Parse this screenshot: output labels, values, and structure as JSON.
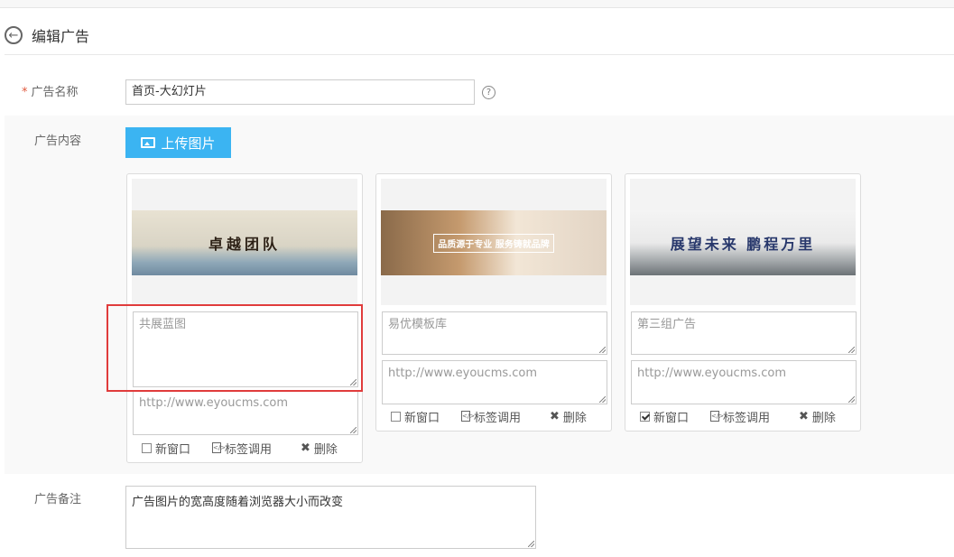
{
  "header": {
    "title": "编辑广告",
    "back_icon": "arrow-left-circle-icon"
  },
  "form": {
    "name_label": "广告名称",
    "required_mark": "*",
    "name_value": "首页-大幻灯片",
    "help_icon": "question-circle-icon",
    "content_label": "广告内容",
    "upload_label": "上传图片",
    "remark_label": "广告备注",
    "remark_value": "广告图片的宽高度随着浏览器大小而改变"
  },
  "cards": [
    {
      "banner_text": "卓越团队",
      "title_placeholder": "共展蓝图",
      "url_placeholder": "http://www.eyoucms.com",
      "new_window_label": "新窗口",
      "new_window_checked": false,
      "tag_label": "标签调用",
      "delete_label": "删除"
    },
    {
      "banner_text": "品质源于专业 服务铸就品牌",
      "title_placeholder": "易优模板库",
      "url_placeholder": "http://www.eyoucms.com",
      "new_window_label": "新窗口",
      "new_window_checked": false,
      "tag_label": "标签调用",
      "delete_label": "删除"
    },
    {
      "banner_text": "展望未来 鹏程万里",
      "title_placeholder": "第三组广告",
      "url_placeholder": "http://www.eyoucms.com",
      "new_window_label": "新窗口",
      "new_window_checked": true,
      "tag_label": "标签调用",
      "delete_label": "删除"
    }
  ],
  "colors": {
    "accent": "#3bb4f2",
    "highlight": "#e03c3c",
    "required": "#e0593d"
  }
}
